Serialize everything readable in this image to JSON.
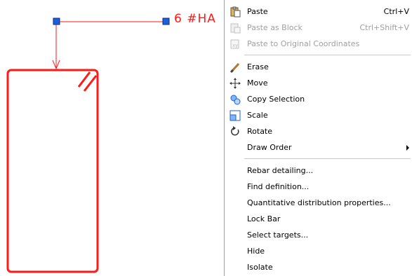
{
  "canvas": {
    "label_text": "6 #HA",
    "line_color": "#ff1a1a",
    "grip_color": "#1f5fd6"
  },
  "menu": {
    "items": [
      {
        "label": "Paste",
        "shortcut": "Ctrl+V",
        "icon": "clipboard-paste-icon",
        "enabled": true
      },
      {
        "label": "Paste as Block",
        "shortcut": "Ctrl+Shift+V",
        "icon": "paste-block-icon",
        "enabled": false
      },
      {
        "label": "Paste to Original Coordinates",
        "shortcut": "",
        "icon": "paste-original-coords-icon",
        "enabled": false
      },
      {
        "label": "Erase",
        "shortcut": "",
        "icon": "eraser-brush-icon",
        "enabled": true
      },
      {
        "label": "Move",
        "shortcut": "",
        "icon": "move-arrows-icon",
        "enabled": true
      },
      {
        "label": "Copy Selection",
        "shortcut": "",
        "icon": "copy-selection-icon",
        "enabled": true
      },
      {
        "label": "Scale",
        "shortcut": "",
        "icon": "scale-icon",
        "enabled": true
      },
      {
        "label": "Rotate",
        "shortcut": "",
        "icon": "rotate-icon",
        "enabled": true
      },
      {
        "label": "Draw Order",
        "shortcut": "",
        "icon": "",
        "enabled": true,
        "submenu": true
      },
      {
        "label": "Rebar detailing...",
        "shortcut": "",
        "icon": "",
        "enabled": true
      },
      {
        "label": "Find definition...",
        "shortcut": "",
        "icon": "",
        "enabled": true
      },
      {
        "label": "Quantitative distribution properties...",
        "shortcut": "",
        "icon": "",
        "enabled": true
      },
      {
        "label": "Lock Bar",
        "shortcut": "",
        "icon": "",
        "enabled": true
      },
      {
        "label": "Select targets...",
        "shortcut": "",
        "icon": "",
        "enabled": true
      },
      {
        "label": "Hide",
        "shortcut": "",
        "icon": "",
        "enabled": true
      },
      {
        "label": "Isolate",
        "shortcut": "",
        "icon": "",
        "enabled": true
      }
    ]
  }
}
